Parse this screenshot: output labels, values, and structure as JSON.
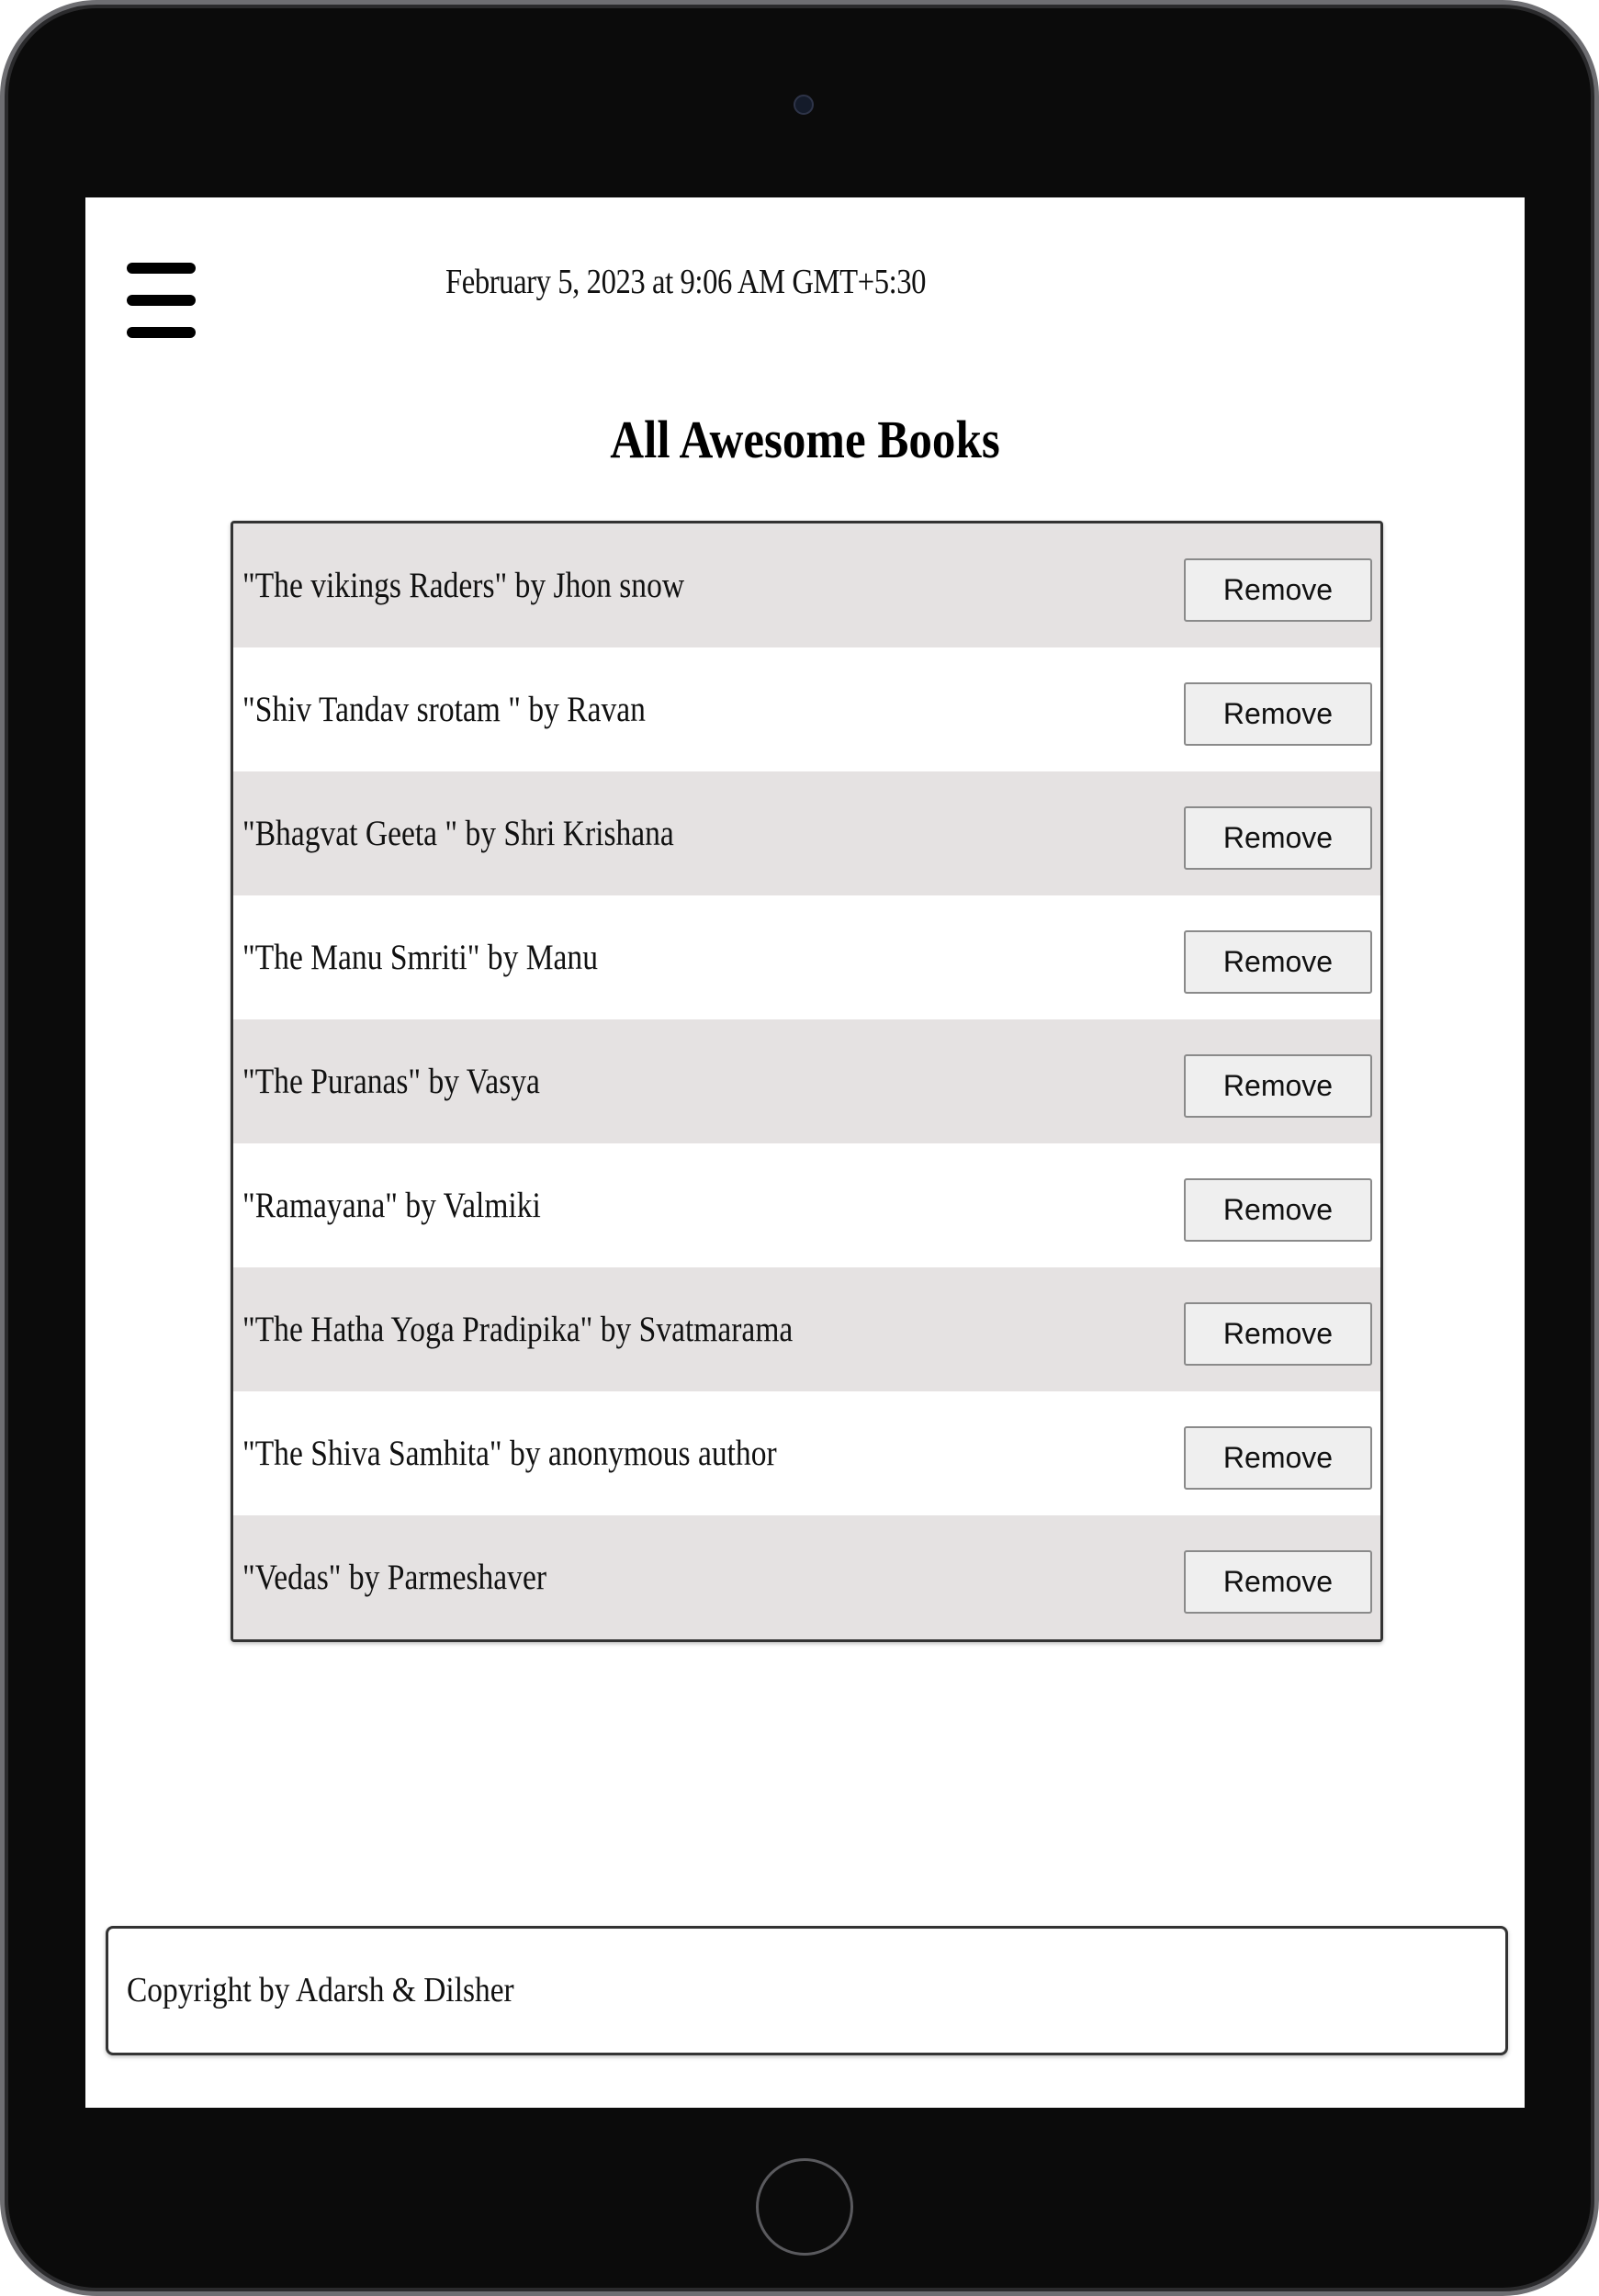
{
  "header": {
    "menu_icon": "hamburger-icon",
    "date": "February 5, 2023 at 9:06 AM GMT+5:30"
  },
  "main": {
    "title": "All Awesome Books",
    "books": [
      {
        "label": "\"The vikings Raders\" by Jhon snow",
        "remove_label": "Remove"
      },
      {
        "label": "\"Shiv Tandav srotam \" by Ravan",
        "remove_label": "Remove"
      },
      {
        "label": "\"Bhagvat Geeta \" by Shri Krishana",
        "remove_label": "Remove"
      },
      {
        "label": "\"The Manu Smriti\" by Manu",
        "remove_label": "Remove"
      },
      {
        "label": "\"The Puranas\" by Vasya",
        "remove_label": "Remove"
      },
      {
        "label": "\"Ramayana\" by Valmiki",
        "remove_label": "Remove"
      },
      {
        "label": "\"The Hatha Yoga Pradipika\" by Svatmarama",
        "remove_label": "Remove"
      },
      {
        "label": "\"The Shiva Samhita\" by anonymous author",
        "remove_label": "Remove"
      },
      {
        "label": "\"Vedas\" by Parmeshaver",
        "remove_label": "Remove"
      }
    ]
  },
  "footer": {
    "text": "Copyright by Adarsh & Dilsher"
  },
  "colors": {
    "device_frame": "#0b0b0b",
    "row_alt": "#e5e2e2",
    "button_bg": "#efefef"
  }
}
